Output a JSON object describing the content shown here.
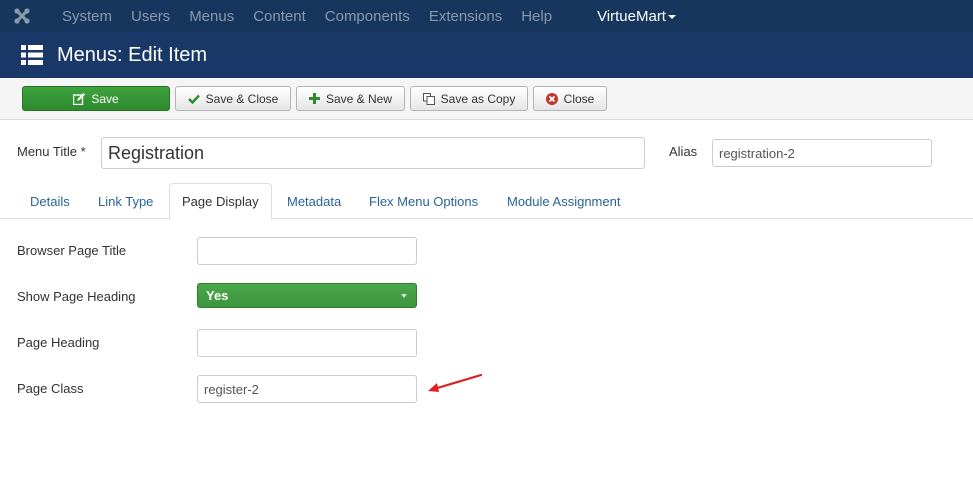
{
  "topnav": {
    "logo_icon": "joomla-logo-icon",
    "items": [
      "System",
      "Users",
      "Menus",
      "Content",
      "Components",
      "Extensions",
      "Help"
    ],
    "virtuemart": "VirtueMart"
  },
  "header": {
    "icon": "list-icon",
    "title": "Menus: Edit Item"
  },
  "toolbar": {
    "save": "Save",
    "save_close": "Save & Close",
    "save_new": "Save & New",
    "save_copy": "Save as Copy",
    "close": "Close"
  },
  "title_row": {
    "menu_title_label": "Menu Title *",
    "menu_title_value": "Registration",
    "alias_label": "Alias",
    "alias_value": "registration-2"
  },
  "tabs": [
    "Details",
    "Link Type",
    "Page Display",
    "Metadata",
    "Flex Menu Options",
    "Module Assignment"
  ],
  "active_tab": "Page Display",
  "form": {
    "browser_page_title_label": "Browser Page Title",
    "browser_page_title_value": "",
    "show_page_heading_label": "Show Page Heading",
    "show_page_heading_value": "Yes",
    "page_heading_label": "Page Heading",
    "page_heading_value": "",
    "page_class_label": "Page Class",
    "page_class_value": "register-2"
  },
  "colors": {
    "nav_bg": "#17365d",
    "header_bg": "#1a3867",
    "save_green": "#3a9a3a",
    "annotation_red": "#e02020"
  }
}
